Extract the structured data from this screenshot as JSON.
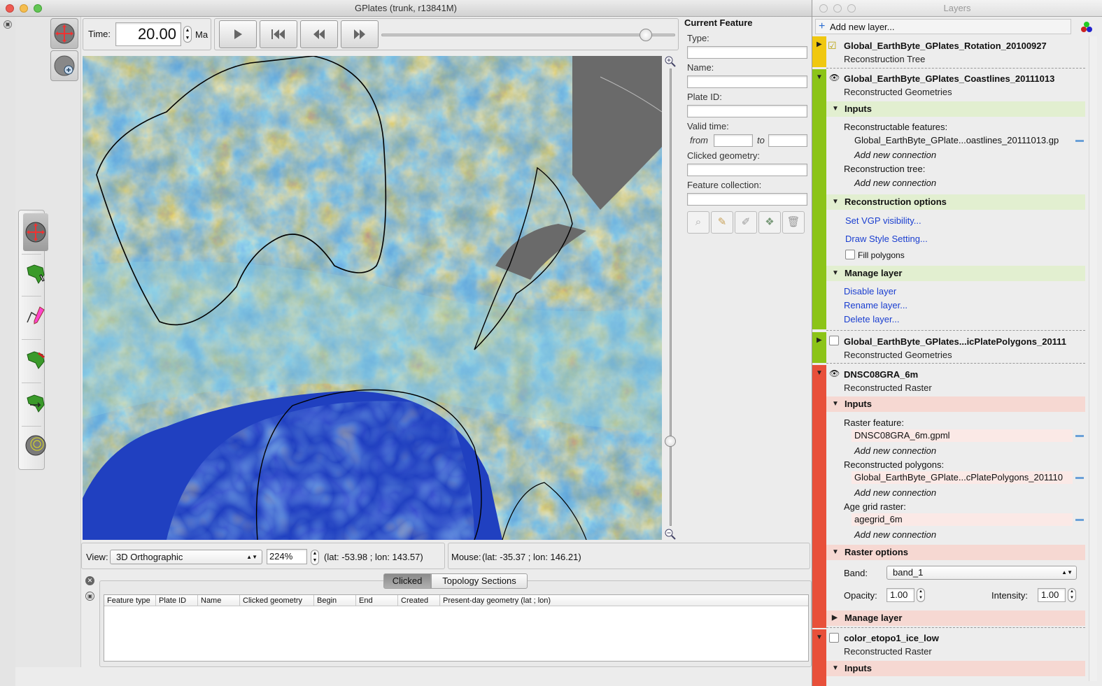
{
  "main_window": {
    "title": "GPlates (trunk, r13841M)"
  },
  "time_bar": {
    "label": "Time:",
    "value": "20.00",
    "unit": "Ma",
    "slider_position": 0.9
  },
  "current_feature": {
    "heading": "Current Feature",
    "type_label": "Type:",
    "name_label": "Name:",
    "plate_id_label": "Plate ID:",
    "valid_time_label": "Valid time:",
    "from_label": "from",
    "to_label": "to",
    "clicked_geometry_label": "Clicked geometry:",
    "feature_collection_label": "Feature collection:"
  },
  "status_bar": {
    "view_label": "View:",
    "view_value": "3D Orthographic",
    "zoom_value": "224%",
    "camera_coords": "(lat: -53.98 ; lon: 143.57)",
    "mouse_label": "Mouse:",
    "mouse_coords": "(lat: -35.37 ; lon: 146.21)"
  },
  "clicked_panel": {
    "tabs": [
      "Clicked",
      "Topology Sections"
    ],
    "active_tab": "Clicked",
    "columns": [
      "Feature type",
      "Plate ID",
      "Name",
      "Clicked geometry",
      "Begin",
      "End",
      "Created",
      "Present-day geometry (lat ; lon)"
    ]
  },
  "layers_window": {
    "title": "Layers",
    "add_layer": "Add new layer...",
    "layers": [
      {
        "name": "Global_EarthByte_GPlates_Rotation_20100927",
        "type": "Reconstruction Tree",
        "color": "#f0c810"
      },
      {
        "name": "Global_EarthByte_GPlates_Coastlines_20111013",
        "type": "Reconstructed Geometries",
        "color": "#8cc418",
        "inputs_label": "Inputs",
        "reconstructable_label": "Reconstructable features:",
        "reconstructable_file": "Global_EarthByte_GPlate...oastlines_20111013.gp",
        "add_connection": "Add new connection",
        "tree_label": "Reconstruction tree:",
        "recon_options_label": "Reconstruction options",
        "vgp_link": "Set VGP visibility...",
        "draw_style_link": "Draw Style Setting...",
        "fill_polygons": "Fill polygons",
        "manage_label": "Manage layer",
        "disable": "Disable layer",
        "rename": "Rename layer...",
        "delete": "Delete layer..."
      },
      {
        "name": "Global_EarthByte_GPlates...icPlatePolygons_20111",
        "type": "Reconstructed Geometries",
        "color": "#8cc418"
      },
      {
        "name": "DNSC08GRA_6m",
        "type": "Reconstructed Raster",
        "color": "#e8503a",
        "inputs_label": "Inputs",
        "raster_feature_label": "Raster feature:",
        "raster_file": "DNSC08GRA_6m.gpml",
        "polygons_label": "Reconstructed polygons:",
        "polygons_file": "Global_EarthByte_GPlate...cPlatePolygons_201110",
        "agegrid_label": "Age grid raster:",
        "agegrid_file": "agegrid_6m",
        "add_connection": "Add new connection",
        "raster_options_label": "Raster options",
        "band_label": "Band:",
        "band_value": "band_1",
        "opacity_label": "Opacity:",
        "opacity_value": "1.00",
        "intensity_label": "Intensity:",
        "intensity_value": "1.00",
        "manage_label": "Manage layer"
      },
      {
        "name": "color_etopo1_ice_low",
        "type": "Reconstructed Raster",
        "color": "#e8503a",
        "inputs_label": "Inputs"
      }
    ]
  },
  "icons": [
    "globe-rotate-icon",
    "globe-zoom-icon",
    "drag-globe-icon",
    "choose-feature-icon",
    "digitise-icon",
    "edit-geometry-icon",
    "move-feature-icon",
    "small-circle-icon",
    "play-icon",
    "step-back-icon",
    "rewind-icon",
    "fast-forward-icon",
    "zoom-in-icon",
    "zoom-out-icon"
  ]
}
